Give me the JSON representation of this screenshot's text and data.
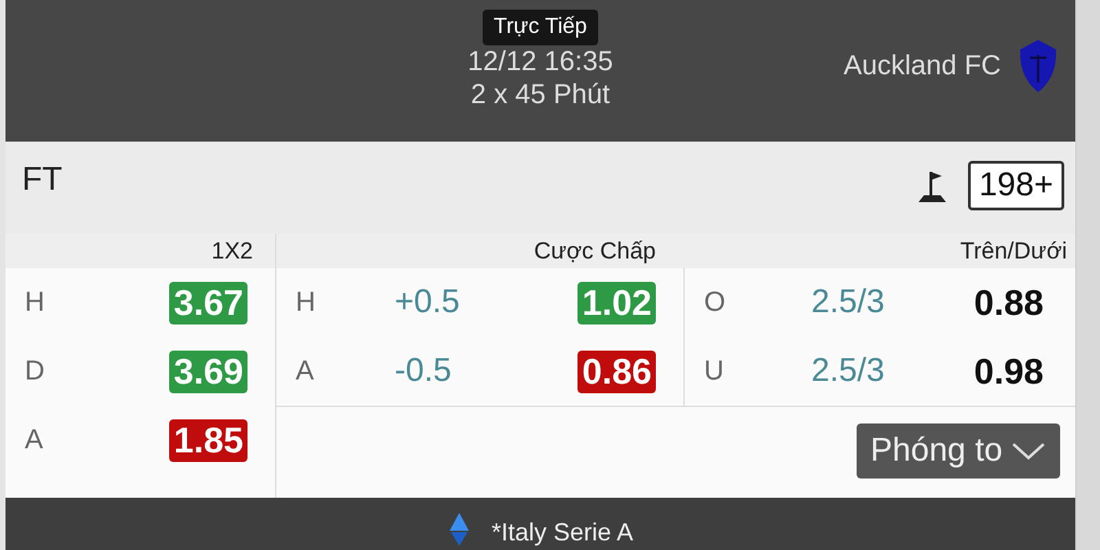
{
  "match": {
    "status_badge": "Trực Tiếp",
    "datetime": "12/12 16:35",
    "duration": "2 x 45 Phút",
    "away_team": "Auckland FC"
  },
  "summary": {
    "period": "FT",
    "more_button": "198+"
  },
  "markets": [
    {
      "title": "1X2",
      "rows": [
        {
          "label": "H",
          "odds": "3.67",
          "color": "#2f9a46"
        },
        {
          "label": "D",
          "odds": "3.69",
          "color": "#2f9a46"
        },
        {
          "label": "A",
          "odds": "1.85",
          "color": "#c00c0c"
        }
      ]
    },
    {
      "title": "Cược Chấp",
      "rows": [
        {
          "label": "H",
          "line": "+0.5",
          "odds": "1.02",
          "color": "#2f9a46"
        },
        {
          "label": "A",
          "line": "-0.5",
          "odds": "0.86",
          "color": "#c00c0c"
        }
      ]
    },
    {
      "title": "Trên/Dưới",
      "rows": [
        {
          "label": "O",
          "line": "2.5/3",
          "odds": "0.88"
        },
        {
          "label": "U",
          "line": "2.5/3",
          "odds": "0.98"
        }
      ]
    }
  ],
  "expand_button": "Phóng to",
  "league": {
    "name": "*Italy Serie A"
  }
}
